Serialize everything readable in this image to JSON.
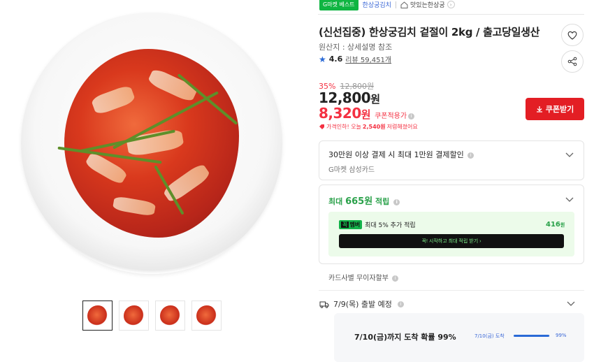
{
  "product": {
    "badge": "G마켓 베스트",
    "seller": "한상궁김치",
    "shop_link": "맛있는한상궁",
    "title": "(신선집중) 한상궁김치 겉절이 2kg / 출고당일생산",
    "origin": "원산지 : 상세설명 참조",
    "rating": "4.6",
    "review_label": "리뷰 59,451개"
  },
  "pricing": {
    "discount_pct": "35%",
    "original_price": "12,800원",
    "price_number": "12,800",
    "price_unit": "원",
    "coupon_price_number": "8,320",
    "coupon_price_unit": "원",
    "coupon_applied_label": "쿠폰적용가",
    "price_drop_prefix": "가격인하! 오늘",
    "price_drop_amount": "2,540원",
    "price_drop_suffix": "저렴해졌어요",
    "coupon_button": "쿠폰받기"
  },
  "card_discount": {
    "title": "30만원 이상 결제 시 최대 1만원 결제할인",
    "subtitle": "G마켓 삼성카드"
  },
  "points": {
    "prefix": "최대",
    "amount": "665원",
    "suffix": "적립",
    "member_badge_k": "꼭",
    "member_badge_label": "멤버",
    "member_text": "최대 5% 추가 적립",
    "member_points_value": "416",
    "member_points_unit": "원",
    "member_cta": "꼭! 시작하고 최대 적립 받기 ›"
  },
  "installment": "카드사별 무이자할부",
  "shipping": {
    "departure": "7/9(목) 출발 예정",
    "arrival_text": "7/10(금)까지 도착 확률 99%",
    "arrival_day_label": "7/10(금) 도착",
    "arrival_pct_label": "99%",
    "arrival_fraction": 0.99
  },
  "gallery": {
    "thumb_count": 4,
    "active_index": 0
  },
  "colors": {
    "accent_red": "#f43142",
    "coupon_button": "#e31e24",
    "points_green": "#2aa14a",
    "link_blue": "#3a67d6"
  }
}
